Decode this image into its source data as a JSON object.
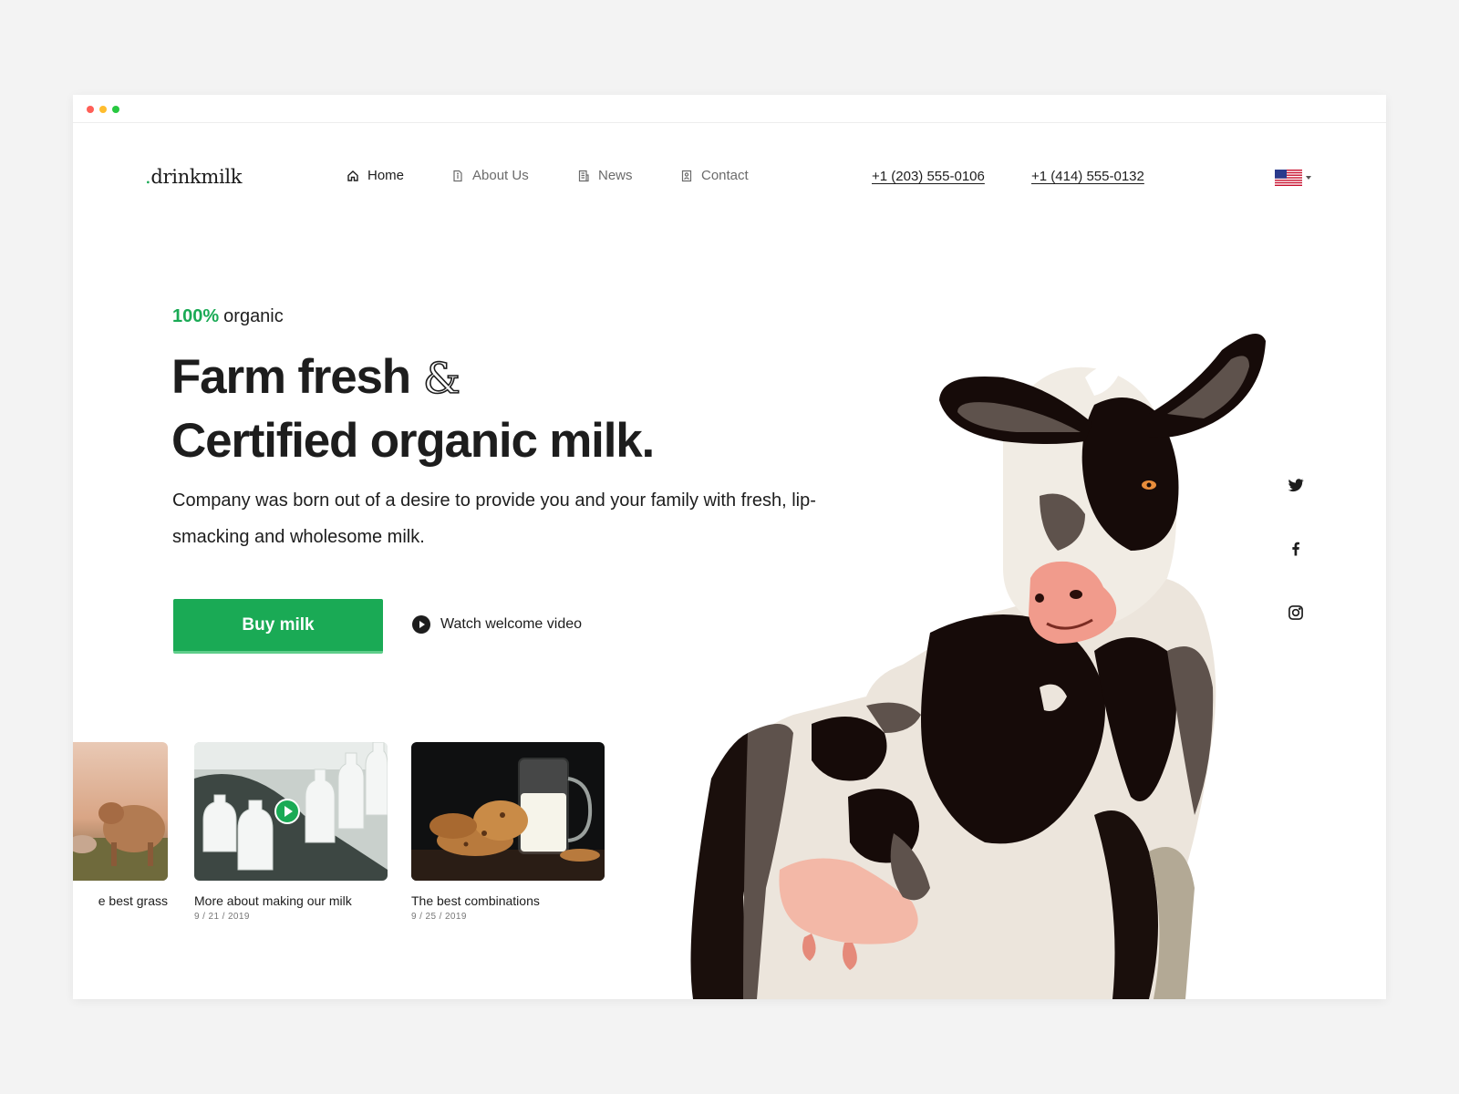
{
  "brand": {
    "dot": ".",
    "name": "drinkmilk"
  },
  "nav": [
    {
      "label": "Home",
      "icon": "home-icon",
      "active": true
    },
    {
      "label": "About Us",
      "icon": "document-icon",
      "active": false
    },
    {
      "label": "News",
      "icon": "newspaper-icon",
      "active": false
    },
    {
      "label": "Contact",
      "icon": "contact-book-icon",
      "active": false
    }
  ],
  "phones": [
    "+1 (203) 555-0106",
    "+1 (414) 555-0132"
  ],
  "language": {
    "icon": "us-flag-icon"
  },
  "hero": {
    "eyebrow_pct": "100%",
    "eyebrow_text": "organic",
    "title_line1": "Farm fresh",
    "ampersand": "&",
    "title_line2": "Certified organic milk.",
    "description": "Company was born out of a desire to provide you and your family with fresh, lip-smacking and wholesome milk.",
    "buy_label": "Buy milk",
    "watch_label": "Watch welcome video"
  },
  "cards": [
    {
      "title": "e best grass",
      "date": ""
    },
    {
      "title": "More about making our milk",
      "date": "9 / 21 / 2019"
    },
    {
      "title": "The best combinations",
      "date": "9 / 25 / 2019"
    }
  ],
  "social": [
    "twitter-icon",
    "facebook-icon",
    "instagram-icon"
  ],
  "colors": {
    "accent": "#1aaa55",
    "text": "#1d1d1d",
    "muted": "#6b6b6b",
    "background": "#f3f3f3"
  }
}
